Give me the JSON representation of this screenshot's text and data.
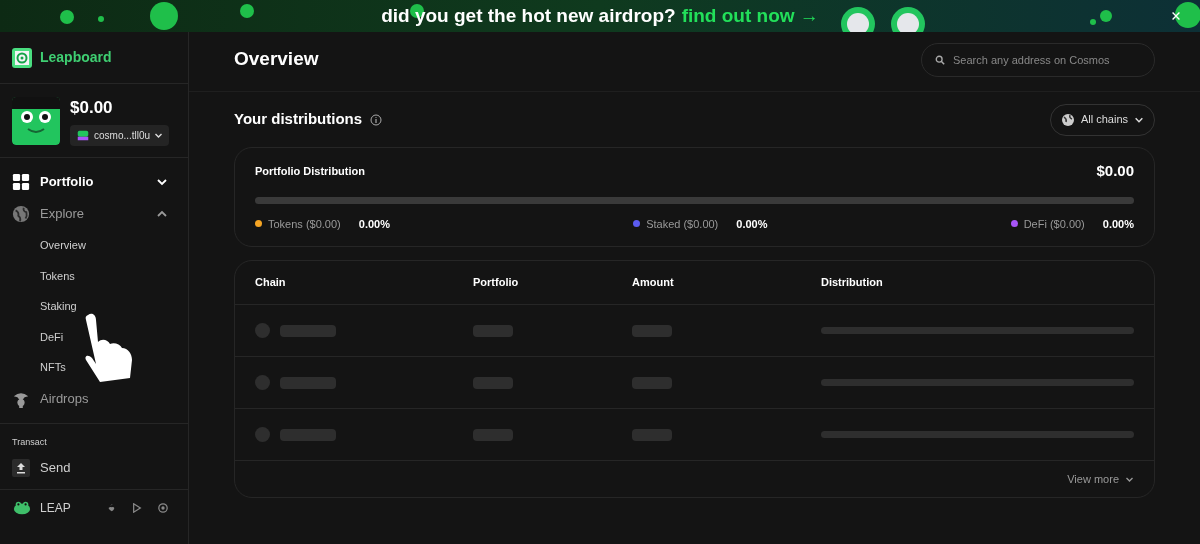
{
  "banner": {
    "text": "did you get the hot new airdrop?",
    "link": "find out now →"
  },
  "sidebar": {
    "brand": "Leapboard",
    "balance": "$0.00",
    "address": "cosmo...tll0u",
    "nav": [
      {
        "label": "Portfolio",
        "kind": "grid",
        "selected": true,
        "expanded": false
      },
      {
        "label": "Explore",
        "kind": "globe",
        "selected": false,
        "expanded": true,
        "children": [
          {
            "label": "Overview"
          },
          {
            "label": "Tokens"
          },
          {
            "label": "Staking"
          },
          {
            "label": "DeFi"
          },
          {
            "label": "NFTs"
          }
        ]
      },
      {
        "label": "Airdrops",
        "kind": "drop",
        "selected": false
      }
    ],
    "section": "Transact",
    "section_items": [
      {
        "label": "Send"
      }
    ],
    "footer": "LEAP"
  },
  "header": {
    "title": "Overview",
    "search": {
      "placeholder": "Search any address on Cosmos"
    }
  },
  "distributions": {
    "title": "Your distributions",
    "filter": "All chains",
    "card": {
      "title": "Portfolio Distribution",
      "total": "$0.00",
      "legend": [
        {
          "label": "Tokens ($0.00)",
          "percent": "0.00%",
          "color": "#f5a524"
        },
        {
          "label": "Staked ($0.00)",
          "percent": "0.00%",
          "color": "#5b5bf0"
        },
        {
          "label": "DeFi ($0.00)",
          "percent": "0.00%",
          "color": "#a855f7"
        }
      ]
    }
  },
  "table": {
    "columns": [
      "Chain",
      "Portfolio",
      "Amount",
      "Distribution"
    ],
    "rows": [
      {
        "kind": "skeleton"
      },
      {
        "kind": "skeleton"
      },
      {
        "kind": "skeleton"
      }
    ],
    "more": "View more"
  }
}
